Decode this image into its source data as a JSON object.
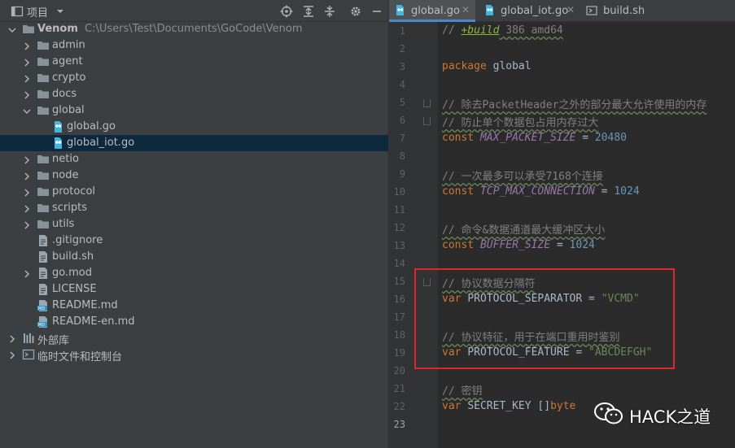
{
  "project_panel": {
    "title": "项目",
    "toolbar_icons": [
      "locate-icon",
      "expand-all-icon",
      "collapse-all-icon",
      "gear-icon",
      "minimize-icon"
    ],
    "tree": [
      {
        "label": "Venom",
        "path": "C:\\Users\\Test\\Documents\\GoCode\\Venom",
        "type": "root-folder",
        "expanded": true
      },
      {
        "label": "admin",
        "type": "folder",
        "expanded": false
      },
      {
        "label": "agent",
        "type": "folder",
        "expanded": false
      },
      {
        "label": "crypto",
        "type": "folder",
        "expanded": false
      },
      {
        "label": "docs",
        "type": "folder",
        "expanded": false
      },
      {
        "label": "global",
        "type": "folder",
        "expanded": true
      },
      {
        "label": "global.go",
        "type": "go-file"
      },
      {
        "label": "global_iot.go",
        "type": "go-file",
        "selected": true
      },
      {
        "label": "netio",
        "type": "folder",
        "expanded": false
      },
      {
        "label": "node",
        "type": "folder",
        "expanded": false
      },
      {
        "label": "protocol",
        "type": "folder",
        "expanded": false
      },
      {
        "label": "scripts",
        "type": "folder",
        "expanded": false
      },
      {
        "label": "utils",
        "type": "folder",
        "expanded": false
      },
      {
        "label": ".gitignore",
        "type": "text-file"
      },
      {
        "label": "build.sh",
        "type": "text-file"
      },
      {
        "label": "go.mod",
        "type": "mod-file",
        "expandable": true
      },
      {
        "label": "LICENSE",
        "type": "text-file"
      },
      {
        "label": "README.md",
        "type": "md-file"
      },
      {
        "label": "README-en.md",
        "type": "md-file"
      },
      {
        "label": "外部库",
        "type": "library"
      },
      {
        "label": "临时文件和控制台",
        "type": "scratches"
      }
    ]
  },
  "editor": {
    "tabs": [
      {
        "label": "global.go",
        "active": true,
        "icon": "go-file-icon"
      },
      {
        "label": "global_iot.go",
        "active": false,
        "icon": "go-file-icon"
      },
      {
        "label": "build.sh",
        "active": false,
        "icon": "shell-file-icon"
      }
    ],
    "current_line": 23,
    "lines": [
      [
        {
          "t": "// ",
          "c": "cmt"
        },
        {
          "t": "+build",
          "c": "bi"
        },
        {
          "t": " 386 amd64",
          "c": "cmt"
        }
      ],
      [],
      [
        {
          "t": "package",
          "c": "kw"
        },
        {
          "t": " global",
          "c": "plain"
        }
      ],
      [],
      [
        {
          "t": "// 除去PacketHeader之外的部分最大允许使用的内存",
          "c": "cmt"
        }
      ],
      [
        {
          "t": "// 防止单个数据包占用内存过大",
          "c": "cmt"
        }
      ],
      [
        {
          "t": "const ",
          "c": "kw"
        },
        {
          "t": "MAX_PACKET_SIZE",
          "c": "const"
        },
        {
          "t": " = ",
          "c": "plain"
        },
        {
          "t": "20480",
          "c": "num"
        }
      ],
      [],
      [
        {
          "t": "// 一次最多可以承受7168个连接",
          "c": "cmt"
        }
      ],
      [
        {
          "t": "const ",
          "c": "kw"
        },
        {
          "t": "TCP_MAX_CONNECTION",
          "c": "const"
        },
        {
          "t": " = ",
          "c": "plain"
        },
        {
          "t": "1024",
          "c": "num"
        }
      ],
      [],
      [
        {
          "t": "// 命令&数据通道最大缓冲区大小",
          "c": "cmt"
        }
      ],
      [
        {
          "t": "const ",
          "c": "kw"
        },
        {
          "t": "BUFFER_SIZE",
          "c": "const"
        },
        {
          "t": " = ",
          "c": "plain"
        },
        {
          "t": "1024",
          "c": "num"
        }
      ],
      [],
      [
        {
          "t": "// 协议数据分隔符",
          "c": "cmt"
        }
      ],
      [
        {
          "t": "var ",
          "c": "kw"
        },
        {
          "t": "PROTOCOL_SEPARATOR",
          "c": "plain"
        },
        {
          "t": " = ",
          "c": "plain"
        },
        {
          "t": "\"VCMD\"",
          "c": "str"
        }
      ],
      [],
      [
        {
          "t": "// 协议特征，用于在端口重用时鉴别",
          "c": "cmt"
        }
      ],
      [
        {
          "t": "var ",
          "c": "kw"
        },
        {
          "t": "PROTOCOL_FEATURE",
          "c": "plain"
        },
        {
          "t": " = ",
          "c": "plain"
        },
        {
          "t": "\"ABCDEFGH\"",
          "c": "str"
        }
      ],
      [],
      [
        {
          "t": "// 密钥",
          "c": "cmt"
        }
      ],
      [
        {
          "t": "var ",
          "c": "kw"
        },
        {
          "t": "SECRET_KEY",
          "c": "plain"
        },
        {
          "t": " []",
          "c": "plain"
        },
        {
          "t": "byte",
          "c": "kw"
        }
      ],
      []
    ]
  },
  "watermark": {
    "text": "HACK之道",
    "icon": "wechat-icon"
  },
  "colors": {
    "highlight_box": "#e0282c",
    "selection": "#0d293e",
    "accent": "#4a88c7"
  }
}
